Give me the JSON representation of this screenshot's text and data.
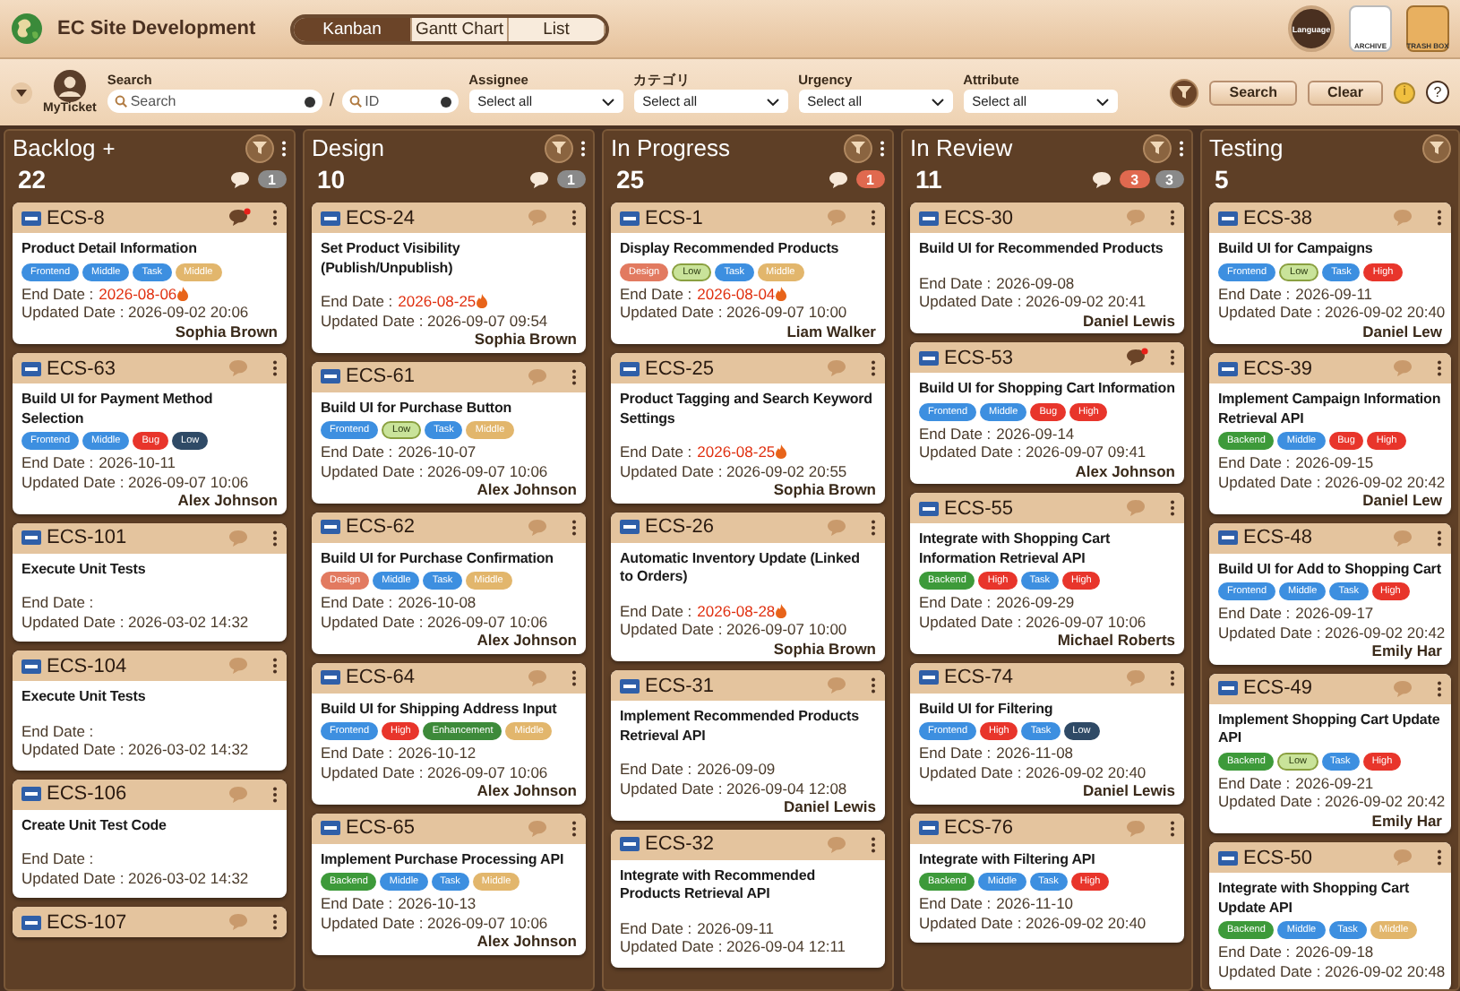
{
  "app": {
    "title": "EC Site Development",
    "views": [
      {
        "label": "Kanban",
        "selected": true
      },
      {
        "label": "Gantt Chart",
        "selected": false
      },
      {
        "label": "List",
        "selected": false
      }
    ],
    "tools": [
      {
        "kind": "globe",
        "label": "Language"
      },
      {
        "kind": "archive",
        "label": "ARCHIVE"
      },
      {
        "kind": "trash",
        "label": "TRASH BOX"
      }
    ]
  },
  "filters": {
    "my_ticket": "MyTicket",
    "search_label": "Search",
    "search": {
      "placeholder": "Search"
    },
    "separator": "/",
    "id": {
      "placeholder": "ID"
    },
    "selects": [
      {
        "label": "Assignee",
        "value": "Select all"
      },
      {
        "label": "カテゴリ",
        "value": "Select all"
      },
      {
        "label": "Urgency",
        "value": "Select all"
      },
      {
        "label": "Attribute",
        "value": "Select all"
      }
    ],
    "buttons": [
      "Search",
      "Clear"
    ],
    "info": "i",
    "help": "?"
  },
  "columns": [
    {
      "name": "Backlog",
      "add": "+",
      "count": "22",
      "badges": [
        {
          "label": "1",
          "color": "#8a8a8a"
        }
      ],
      "cards": [
        {
          "id": "ECS-8",
          "new_comment": true,
          "title": "Product Detail Information",
          "tags": [
            {
              "label": "Frontend",
              "color": "#3d8fe0"
            },
            {
              "label": "Middle",
              "color": "#3d8fe0"
            },
            {
              "label": "Task",
              "color": "#3d8fe0"
            },
            {
              "label": "Middle",
              "color": "#e2b66c"
            }
          ],
          "end": {
            "label": "End Date :",
            "date": "2026-08-06",
            "overdue": true
          },
          "updated": "Updated Date : 2026-09-02 20:06",
          "assignee": "Sophia Brown"
        },
        {
          "id": "ECS-63",
          "new_comment": false,
          "title": "Build UI for Payment Method Selection",
          "tags": [
            {
              "label": "Frontend",
              "color": "#3d8fe0"
            },
            {
              "label": "Middle",
              "color": "#3d8fe0"
            },
            {
              "label": "Bug",
              "color": "#e8352b"
            },
            {
              "label": "Low",
              "color": "#2f4a66"
            }
          ],
          "end": {
            "label": "End Date :",
            "date": "2026-10-11",
            "overdue": false
          },
          "updated": "Updated Date : 2026-09-07 10:06",
          "assignee": "Alex Johnson"
        },
        {
          "id": "ECS-101",
          "new_comment": false,
          "title": "Execute Unit Tests",
          "end": {
            "label": "End Date :"
          },
          "updated": "Updated Date : 2026-03-02 14:32"
        },
        {
          "id": "ECS-104",
          "new_comment": false,
          "title": "Execute Unit Tests",
          "end": {
            "label": "End Date :"
          },
          "updated": "Updated Date : 2026-03-02 14:32"
        },
        {
          "id": "ECS-106",
          "new_comment": false,
          "title": "Create Unit Test Code",
          "end": {
            "label": "End Date :"
          },
          "updated": "Updated Date : 2026-03-02 14:32"
        },
        {
          "id": "ECS-107",
          "new_comment": false
        }
      ]
    },
    {
      "name": "Design",
      "count": "10",
      "badges": [
        {
          "label": "1",
          "color": "#8a8a8a"
        }
      ],
      "cards": [
        {
          "id": "ECS-24",
          "new_comment": false,
          "title": "Set Product Visibility (Publish/Unpublish)",
          "end": {
            "label": "End Date :",
            "date": "2026-08-25",
            "overdue": true
          },
          "updated": "Updated Date : 2026-09-07 09:54",
          "assignee": "Sophia Brown"
        },
        {
          "id": "ECS-61",
          "new_comment": false,
          "title": "Build UI for Purchase Button",
          "tags": [
            {
              "label": "Frontend",
              "color": "#3d8fe0"
            },
            {
              "label": "Low",
              "color": "#c9e39a"
            },
            {
              "label": "Task",
              "color": "#3d8fe0"
            },
            {
              "label": "Middle",
              "color": "#e2b66c"
            }
          ],
          "end": {
            "label": "End Date :",
            "date": "2026-10-07",
            "overdue": false
          },
          "updated": "Updated Date : 2026-09-07 10:06",
          "assignee": "Alex Johnson"
        },
        {
          "id": "ECS-62",
          "new_comment": false,
          "title": "Build UI for Purchase Confirmation",
          "tags": [
            {
              "label": "Design",
              "color": "#e27a60"
            },
            {
              "label": "Middle",
              "color": "#3d8fe0"
            },
            {
              "label": "Task",
              "color": "#3d8fe0"
            },
            {
              "label": "Middle",
              "color": "#e2b66c"
            }
          ],
          "end": {
            "label": "End Date :",
            "date": "2026-10-08",
            "overdue": false
          },
          "updated": "Updated Date : 2026-09-07 10:06",
          "assignee": "Alex Johnson"
        },
        {
          "id": "ECS-64",
          "new_comment": false,
          "title": "Build UI for Shipping Address Input",
          "tags": [
            {
              "label": "Frontend",
              "color": "#3d8fe0"
            },
            {
              "label": "High",
              "color": "#e8352b"
            },
            {
              "label": "Enhancement",
              "color": "#3d8a3a"
            },
            {
              "label": "Middle",
              "color": "#e2b66c"
            }
          ],
          "end": {
            "label": "End Date :",
            "date": "2026-10-12",
            "overdue": false
          },
          "updated": "Updated Date : 2026-09-07 10:06",
          "assignee": "Alex Johnson"
        },
        {
          "id": "ECS-65",
          "new_comment": false,
          "title": "Implement Purchase Processing API",
          "tags": [
            {
              "label": "Backend",
              "color": "#3d9a3a"
            },
            {
              "label": "Middle",
              "color": "#3d8fe0"
            },
            {
              "label": "Task",
              "color": "#3d8fe0"
            },
            {
              "label": "Middle",
              "color": "#e2b66c"
            }
          ],
          "end": {
            "label": "End Date :",
            "date": "2026-10-13",
            "overdue": false
          },
          "updated": "Updated Date : 2026-09-07 10:06",
          "assignee": "Alex Johnson"
        }
      ]
    },
    {
      "name": "In Progress",
      "count": "25",
      "badges": [
        {
          "label": "1",
          "color": "#e0694f"
        }
      ],
      "cards": [
        {
          "id": "ECS-1",
          "new_comment": false,
          "title": "Display Recommended Products",
          "tags": [
            {
              "label": "Design",
              "color": "#e27a60"
            },
            {
              "label": "Low",
              "color": "#c9e39a"
            },
            {
              "label": "Task",
              "color": "#3d8fe0"
            },
            {
              "label": "Middle",
              "color": "#e2b66c"
            }
          ],
          "end": {
            "label": "End Date :",
            "date": "2026-08-04",
            "overdue": true
          },
          "updated": "Updated Date : 2026-09-07 10:00",
          "assignee": "Liam Walker"
        },
        {
          "id": "ECS-25",
          "new_comment": false,
          "title": "Product Tagging and Search Keyword Settings",
          "end": {
            "label": "End Date :",
            "date": "2026-08-25",
            "overdue": true
          },
          "updated": "Updated Date : 2026-09-02 20:55",
          "assignee": "Sophia Brown"
        },
        {
          "id": "ECS-26",
          "new_comment": false,
          "title": "Automatic Inventory Update (Linked to Orders)",
          "end": {
            "label": "End Date :",
            "date": "2026-08-28",
            "overdue": true
          },
          "updated": "Updated Date : 2026-09-07 10:00",
          "assignee": "Sophia Brown"
        },
        {
          "id": "ECS-31",
          "new_comment": false,
          "title": "Implement Recommended Products Retrieval API",
          "end": {
            "label": "End Date :",
            "date": "2026-09-09",
            "overdue": false
          },
          "updated": "Updated Date : 2026-09-04 12:08",
          "assignee": "Daniel Lewis"
        },
        {
          "id": "ECS-32",
          "new_comment": false,
          "title": "Integrate with Recommended Products Retrieval API",
          "end": {
            "label": "End Date :",
            "date": "2026-09-11",
            "overdue": false
          },
          "updated": "Updated Date : 2026-09-04 12:11"
        }
      ]
    },
    {
      "name": "In Review",
      "count": "11",
      "badges": [
        {
          "label": "3",
          "color": "#e0694f"
        },
        {
          "label": "3",
          "color": "#8a8a8a"
        }
      ],
      "cards": [
        {
          "id": "ECS-30",
          "new_comment": false,
          "title": "Build UI for Recommended Products",
          "end": {
            "label": "End Date :",
            "date": "2026-09-08",
            "overdue": false
          },
          "updated": "Updated Date : 2026-09-02 20:41",
          "assignee": "Daniel Lewis"
        },
        {
          "id": "ECS-53",
          "new_comment": true,
          "title": "Build UI for Shopping Cart Information",
          "tags": [
            {
              "label": "Frontend",
              "color": "#3d8fe0"
            },
            {
              "label": "Middle",
              "color": "#3d8fe0"
            },
            {
              "label": "Bug",
              "color": "#e8352b"
            },
            {
              "label": "High",
              "color": "#e8352b"
            }
          ],
          "end": {
            "label": "End Date :",
            "date": "2026-09-14",
            "overdue": false
          },
          "updated": "Updated Date : 2026-09-07 09:41",
          "assignee": "Alex Johnson"
        },
        {
          "id": "ECS-55",
          "new_comment": false,
          "title": "Integrate with Shopping Cart Information Retrieval API",
          "tags": [
            {
              "label": "Backend",
              "color": "#3d9a3a"
            },
            {
              "label": "High",
              "color": "#e8352b"
            },
            {
              "label": "Task",
              "color": "#3d8fe0"
            },
            {
              "label": "High",
              "color": "#e8352b"
            }
          ],
          "end": {
            "label": "End Date :",
            "date": "2026-09-29",
            "overdue": false
          },
          "updated": "Updated Date : 2026-09-07 10:06",
          "assignee": "Michael Roberts"
        },
        {
          "id": "ECS-74",
          "new_comment": false,
          "title": "Build UI for Filtering",
          "tags": [
            {
              "label": "Frontend",
              "color": "#3d8fe0"
            },
            {
              "label": "High",
              "color": "#e8352b"
            },
            {
              "label": "Task",
              "color": "#3d8fe0"
            },
            {
              "label": "Low",
              "color": "#2f4a66"
            }
          ],
          "end": {
            "label": "End Date :",
            "date": "2026-11-08",
            "overdue": false
          },
          "updated": "Updated Date : 2026-09-02 20:40",
          "assignee": "Daniel Lewis"
        },
        {
          "id": "ECS-76",
          "new_comment": false,
          "title": "Integrate with Filtering API",
          "tags": [
            {
              "label": "Backend",
              "color": "#3d9a3a"
            },
            {
              "label": "Middle",
              "color": "#3d8fe0"
            },
            {
              "label": "Task",
              "color": "#3d8fe0"
            },
            {
              "label": "High",
              "color": "#e8352b"
            }
          ],
          "end": {
            "label": "End Date :",
            "date": "2026-11-10",
            "overdue": false
          },
          "updated": "Updated Date : 2026-09-02 20:40"
        }
      ]
    },
    {
      "name": "Testing",
      "count": "5",
      "cards": [
        {
          "id": "ECS-38",
          "new_comment": false,
          "title": "Build UI for Campaigns",
          "tags": [
            {
              "label": "Frontend",
              "color": "#3d8fe0"
            },
            {
              "label": "Low",
              "color": "#c9e39a"
            },
            {
              "label": "Task",
              "color": "#3d8fe0"
            },
            {
              "label": "High",
              "color": "#e8352b"
            }
          ],
          "end": {
            "label": "End Date :",
            "date": "2026-09-11",
            "overdue": false
          },
          "updated": "Updated Date : 2026-09-02 20:40",
          "assignee": "Daniel Lew"
        },
        {
          "id": "ECS-39",
          "new_comment": false,
          "title": "Implement Campaign Information Retrieval API",
          "tags": [
            {
              "label": "Backend",
              "color": "#3d9a3a"
            },
            {
              "label": "Middle",
              "color": "#3d8fe0"
            },
            {
              "label": "Bug",
              "color": "#e8352b"
            },
            {
              "label": "High",
              "color": "#e8352b"
            }
          ],
          "end": {
            "label": "End Date :",
            "date": "2026-09-15",
            "overdue": false
          },
          "updated": "Updated Date : 2026-09-02 20:42",
          "assignee": "Daniel Lew"
        },
        {
          "id": "ECS-48",
          "new_comment": false,
          "title": "Build UI for Add to Shopping Cart",
          "tags": [
            {
              "label": "Frontend",
              "color": "#3d8fe0"
            },
            {
              "label": "Middle",
              "color": "#3d8fe0"
            },
            {
              "label": "Task",
              "color": "#3d8fe0"
            },
            {
              "label": "High",
              "color": "#e8352b"
            }
          ],
          "end": {
            "label": "End Date :",
            "date": "2026-09-17",
            "overdue": false
          },
          "updated": "Updated Date : 2026-09-02 20:42",
          "assignee": "Emily Har"
        },
        {
          "id": "ECS-49",
          "new_comment": false,
          "title": "Implement Shopping Cart Update API",
          "tags": [
            {
              "label": "Backend",
              "color": "#3d9a3a"
            },
            {
              "label": "Low",
              "color": "#c9e39a"
            },
            {
              "label": "Task",
              "color": "#3d8fe0"
            },
            {
              "label": "High",
              "color": "#e8352b"
            }
          ],
          "end": {
            "label": "End Date :",
            "date": "2026-09-21",
            "overdue": false
          },
          "updated": "Updated Date : 2026-09-02 20:42",
          "assignee": "Emily Har"
        },
        {
          "id": "ECS-50",
          "new_comment": false,
          "title": "Integrate with Shopping Cart Update API",
          "tags": [
            {
              "label": "Backend",
              "color": "#3d9a3a"
            },
            {
              "label": "Middle",
              "color": "#3d8fe0"
            },
            {
              "label": "Task",
              "color": "#3d8fe0"
            },
            {
              "label": "Middle",
              "color": "#e2b66c"
            }
          ],
          "end": {
            "label": "End Date :",
            "date": "2026-09-18",
            "overdue": false
          },
          "updated": "Updated Date : 2026-09-02 20:48"
        }
      ]
    }
  ]
}
